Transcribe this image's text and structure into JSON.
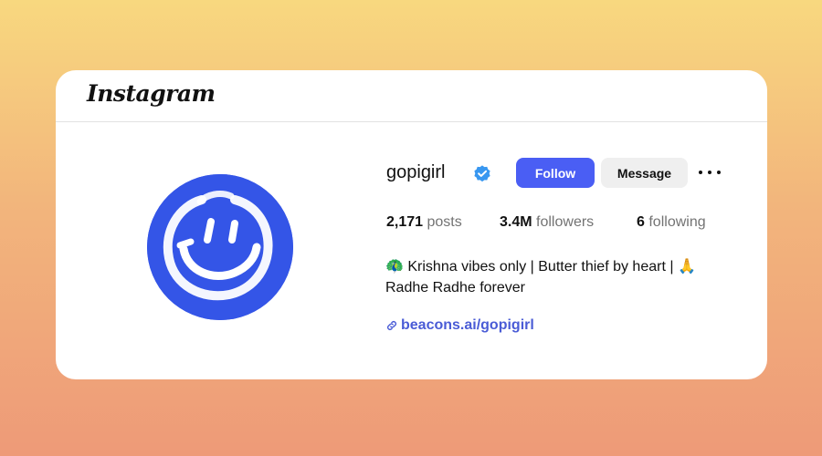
{
  "app": {
    "logo_text": "Instagram"
  },
  "profile": {
    "username": "gopigirl",
    "verified": true,
    "avatar_icon": "smiley-face-icon",
    "avatar_color": "#3455e7"
  },
  "actions": {
    "follow_label": "Follow",
    "message_label": "Message",
    "more_icon": "more-options-icon"
  },
  "stats": [
    {
      "value": "2,171",
      "label": "posts"
    },
    {
      "value": "3.4M",
      "label": "followers"
    },
    {
      "value": "6",
      "label": "following"
    }
  ],
  "bio": {
    "text": "🦚 Krishna vibes only | Butter thief by heart | 🙏 Radhe Radhe forever"
  },
  "link": {
    "icon": "link-icon",
    "text": "beacons.ai/gopigirl"
  },
  "colors": {
    "accent": "#4a5ef4",
    "verified_badge": "#3897f0",
    "link": "#4a5cd6"
  }
}
